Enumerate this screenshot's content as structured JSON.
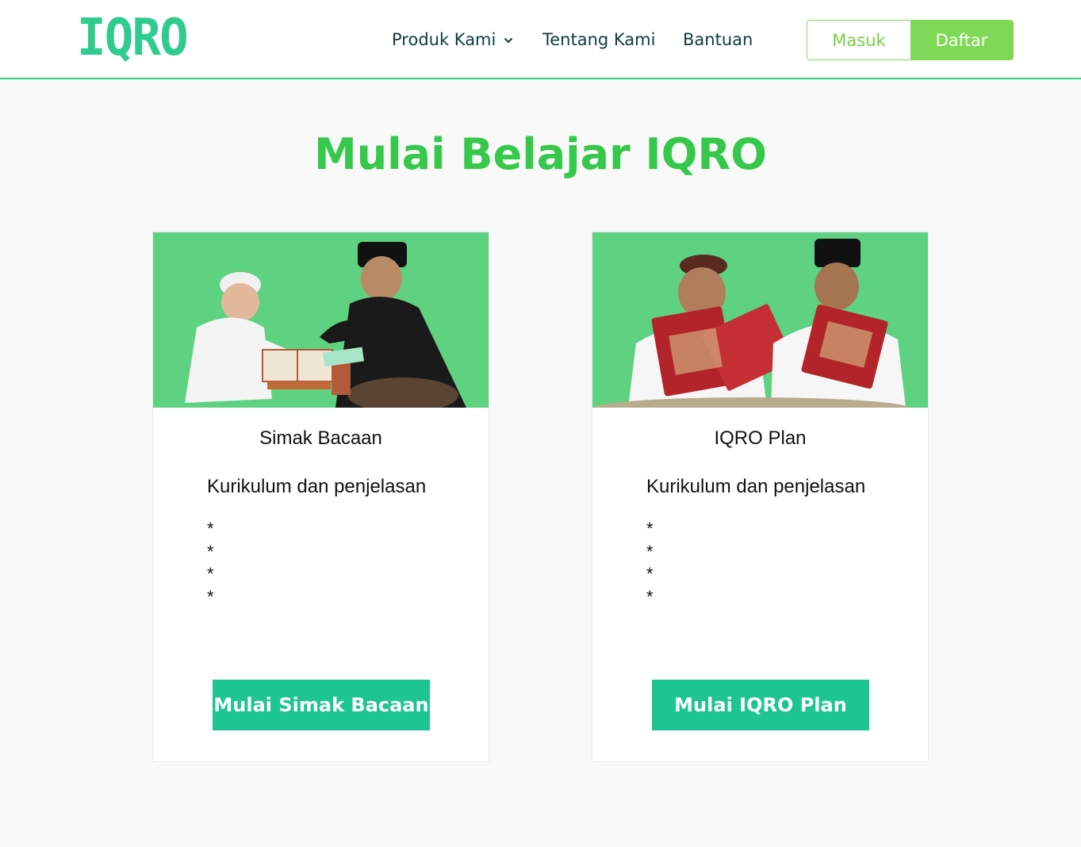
{
  "navbar": {
    "logo_text": "IQRO",
    "links": [
      {
        "label": "Produk Kami",
        "has_dropdown": true,
        "icon": "chevron-down-icon"
      },
      {
        "label": "Tentang Kami"
      },
      {
        "label": "Bantuan"
      }
    ],
    "login_label": "Masuk",
    "register_label": "Daftar"
  },
  "main": {
    "title": "Mulai Belajar IQRO",
    "cards": [
      {
        "image_alt": "Boy reading Quran with teacher",
        "title": "Simak Bacaan",
        "subtitle": "Kurikulum dan penjelasan",
        "bullets": [
          "*",
          "*",
          "*",
          "*"
        ],
        "button_label": "Mulai Simak Bacaan"
      },
      {
        "image_alt": "Two boys reading Quran",
        "title": "IQRO Plan",
        "subtitle": "Kurikulum dan penjelasan",
        "bullets": [
          "*",
          "*",
          "*",
          "*"
        ],
        "button_label": "Mulai IQRO Plan"
      }
    ]
  },
  "colors": {
    "logo": "#2fcb8f",
    "nav_text": "#0f3b3a",
    "title_green": "#36c84a",
    "auth_green": "#7ed957",
    "button_teal": "#1dc591",
    "image_bg": "#5ed280",
    "page_bg": "#f9f9f9"
  }
}
